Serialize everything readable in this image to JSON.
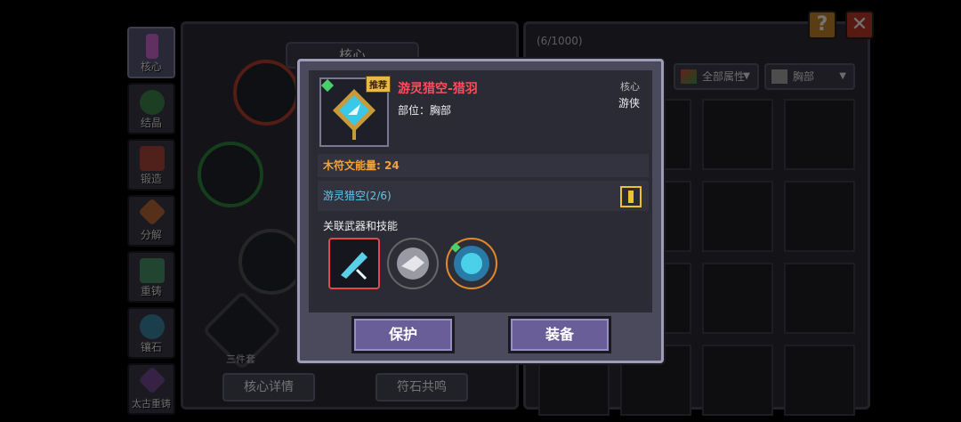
{
  "sidebar": {
    "items": [
      {
        "label": "核心",
        "icon": "core-icon",
        "color": "#d46ad8"
      },
      {
        "label": "结晶",
        "icon": "crystal-icon",
        "color": "#3e8a4e"
      },
      {
        "label": "锻造",
        "icon": "forge-icon",
        "color": "#b04a3a"
      },
      {
        "label": "分解",
        "icon": "decompose-icon",
        "color": "#c06a3a"
      },
      {
        "label": "重铸",
        "icon": "recast-icon",
        "color": "#4a9a6a"
      },
      {
        "label": "镶石",
        "icon": "inlay-icon",
        "color": "#3a8aa8"
      },
      {
        "label": "太古重铸",
        "icon": "ancient-recast-icon",
        "color": "#7a4a98"
      }
    ]
  },
  "mid": {
    "title": "核心",
    "set_label": "三件套",
    "detail_button": "核心详情",
    "resonance_button": "符石共鸣"
  },
  "right": {
    "count": "(6/1000)",
    "filter_attr": "全部属性",
    "filter_part": "胸部"
  },
  "top": {
    "help": "?",
    "close": "✕"
  },
  "modal": {
    "badge": "推荐",
    "item_name": "游灵猎空-猎羽",
    "item_part": "部位：胸部",
    "item_type": "核心",
    "item_class": "游侠",
    "energy": "木符文能量: 24",
    "set_name": "游灵猎空(2/6)",
    "linked_label": "关联武器和技能",
    "protect_button": "保护",
    "equip_button": "装备"
  },
  "colors": {
    "rarity_red": "#ff4d5a",
    "energy_orange": "#f2a23a",
    "set_cyan": "#5ec8e8",
    "button_purple": "#6a5e98"
  }
}
